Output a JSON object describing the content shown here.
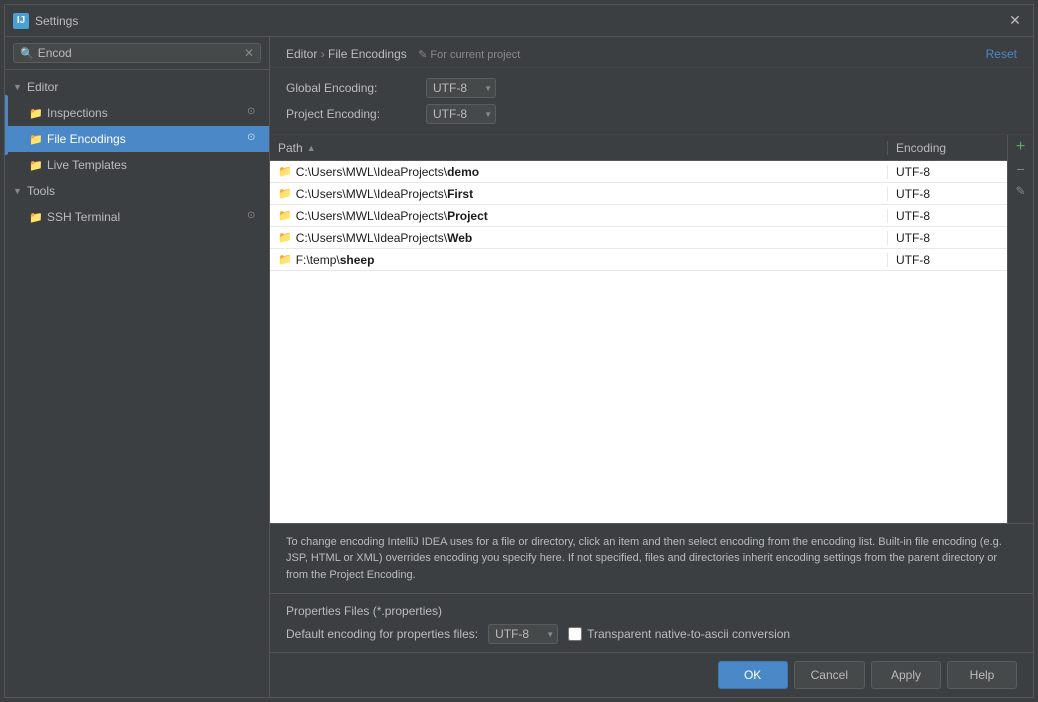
{
  "title": "Settings",
  "search": {
    "value": "Encod",
    "placeholder": "Search"
  },
  "sidebar": {
    "editor_label": "Editor",
    "items": [
      {
        "id": "inspections",
        "label": "Inspections",
        "indent": true,
        "hasBadge": true
      },
      {
        "id": "file-encodings",
        "label": "File Encodings",
        "indent": true,
        "hasBadge": true,
        "selected": true
      },
      {
        "id": "live-templates",
        "label": "Live Templates",
        "indent": true,
        "hasBadge": false
      }
    ],
    "tools_label": "Tools",
    "tools_items": [
      {
        "id": "ssh-terminal",
        "label": "SSH Terminal",
        "hasBadge": true
      }
    ]
  },
  "panel": {
    "breadcrumb_editor": "Editor",
    "breadcrumb_sep": " › ",
    "breadcrumb_page": "File Encodings",
    "note": "✎ For current project",
    "reset_label": "Reset"
  },
  "encodings": {
    "global_label": "Global Encoding:",
    "global_value": "UTF-8",
    "project_label": "Project Encoding:",
    "project_value": "UTF-8"
  },
  "table": {
    "col_path": "Path",
    "col_encoding": "Encoding",
    "rows": [
      {
        "path": "C:\\Users\\MWL\\IdeaProjects\\demo",
        "bold_part": "demo",
        "encoding": "UTF-8"
      },
      {
        "path": "C:\\Users\\MWL\\IdeaProjects\\First",
        "bold_part": "First",
        "encoding": "UTF-8"
      },
      {
        "path": "C:\\Users\\MWL\\IdeaProjects\\Project",
        "bold_part": "Project",
        "encoding": "UTF-8"
      },
      {
        "path": "C:\\Users\\MWL\\IdeaProjects\\Web",
        "bold_part": "Web",
        "encoding": "UTF-8"
      },
      {
        "path": "F:\\temp\\sheep",
        "bold_part": "sheep",
        "encoding": "UTF-8"
      }
    ]
  },
  "info": {
    "text": "To change encoding IntelliJ IDEA uses for a file or directory, click an item and then select encoding from the encoding list. Built-in file encoding (e.g. JSP, HTML or XML) overrides encoding you specify here. If not specified, files and directories inherit encoding settings from the parent directory or from the Project Encoding."
  },
  "properties": {
    "title": "Properties Files (*.properties)",
    "default_label": "Default encoding for properties files:",
    "default_value": "UTF-8",
    "checkbox_label": "Transparent native-to-ascii conversion",
    "checkbox_checked": false
  },
  "buttons": {
    "ok": "OK",
    "cancel": "Cancel",
    "apply": "Apply",
    "help": "Help"
  }
}
